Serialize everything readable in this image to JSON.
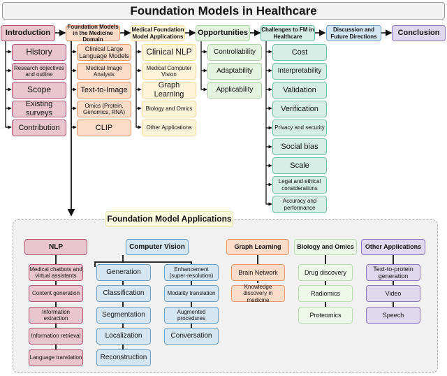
{
  "title": "Foundation Models in Healthcare",
  "top_flow": [
    {
      "label": "Introduction",
      "children": [
        "History",
        "Research objectives and outline",
        "Scope",
        "Existing surveys",
        "Contribution"
      ]
    },
    {
      "label": "Foundation Models in the Medicine Domain",
      "children": [
        "Clinical Large Language Models",
        "Medical Image Analysis",
        "Text-to-Image",
        "Omics (Protein, Genomics, RNA)",
        "CLIP"
      ]
    },
    {
      "label": "Medical Foundation Model Applications",
      "children": [
        "Clinical NLP",
        "Medical Computer Vision",
        "Graph Learning",
        "Biology and Omics",
        "Other Applications"
      ]
    },
    {
      "label": "Opportunities",
      "children": [
        "Controllability",
        "Adaptability",
        "Applicability"
      ]
    },
    {
      "label": "Challenges to FM in Healthcare",
      "children": [
        "Cost",
        "Interpretability",
        "Validation",
        "Verification",
        "Privacy and security",
        "Social bias",
        "Scale",
        "Legal and ethical considerations",
        "Accuracy and performance"
      ]
    },
    {
      "label": "Discussion and Future Directions",
      "children": []
    },
    {
      "label": "Conclusion",
      "children": []
    }
  ],
  "applications_panel": {
    "title": "Foundation Model Applications",
    "nlp": {
      "label": "NLP",
      "children": [
        "Medical chatbots and virtual assistants",
        "Content generation",
        "Information extraction",
        "Information retrieval",
        "Language translation"
      ]
    },
    "cv": {
      "label": "Computer Vision",
      "left": [
        "Generation",
        "Classification",
        "Segmentation",
        "Localization",
        "Reconstruction"
      ],
      "right": [
        "Enhancement (super-resolution)",
        "Modality translation",
        "Augmented procedures",
        "Conversation"
      ]
    },
    "graph": {
      "label": "Graph Learning",
      "children": [
        "Brain Network",
        "Knowledge discovery in medicine"
      ]
    },
    "bio": {
      "label": "Biology and Omics",
      "children": [
        "Drug discovery",
        "Radiomics",
        "Proteomics"
      ]
    },
    "other": {
      "label": "Other Applications",
      "children": [
        "Text-to-protein generation",
        "Video",
        "Speech"
      ]
    }
  }
}
